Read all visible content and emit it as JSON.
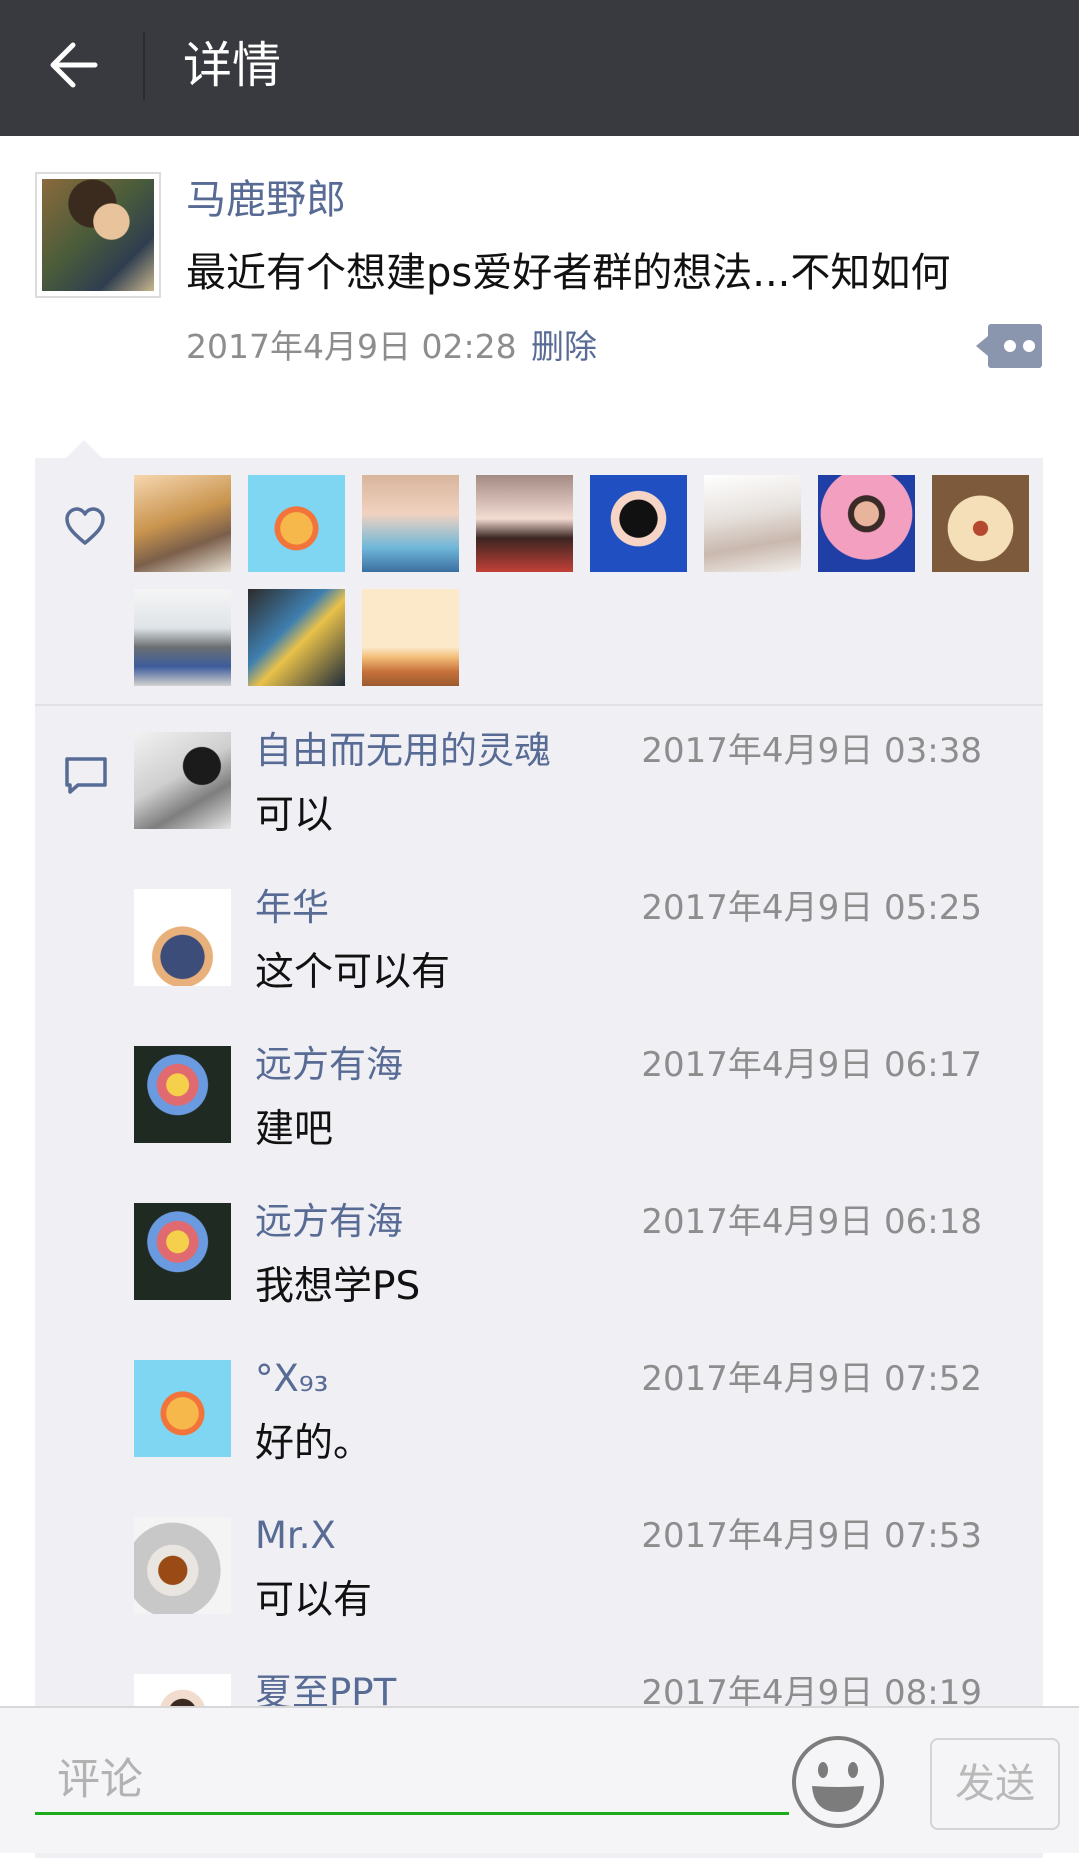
{
  "header": {
    "title": "详情",
    "back_icon": "arrow-left-icon"
  },
  "post": {
    "author": "马鹿野郎",
    "text": "最近有个想建ps爱好者群的想法...不知如何",
    "time": "2017年4月9日 02:28",
    "delete_label": "删除",
    "more_icon": "more-dots-icon",
    "link_color": "#576b95"
  },
  "likes": {
    "icon": "heart-icon",
    "count_shown": 11
  },
  "comments": {
    "icon": "comment-bubble-icon",
    "items": [
      {
        "name": "自由而无用的灵魂",
        "time": "2017年4月9日 03:38",
        "text": "可以"
      },
      {
        "name": "年华",
        "time": "2017年4月9日 05:25",
        "text": "这个可以有"
      },
      {
        "name": "远方有海",
        "time": "2017年4月9日 06:17",
        "text": "建吧"
      },
      {
        "name": "远方有海",
        "time": "2017年4月9日 06:18",
        "text": "我想学PS"
      },
      {
        "name": "°X₉₃",
        "time": "2017年4月9日 07:52",
        "text": "好的。"
      },
      {
        "name": "Mr.X",
        "time": "2017年4月9日 07:53",
        "text": "可以有"
      },
      {
        "name": "夏至PPT",
        "time": "2017年4月9日 08:19",
        "text": ""
      }
    ]
  },
  "footer": {
    "input_placeholder": "评论",
    "input_value": "",
    "emoji_icon": "smiley-face-icon",
    "send_label": "发送",
    "accent_color": "#1aad19"
  }
}
